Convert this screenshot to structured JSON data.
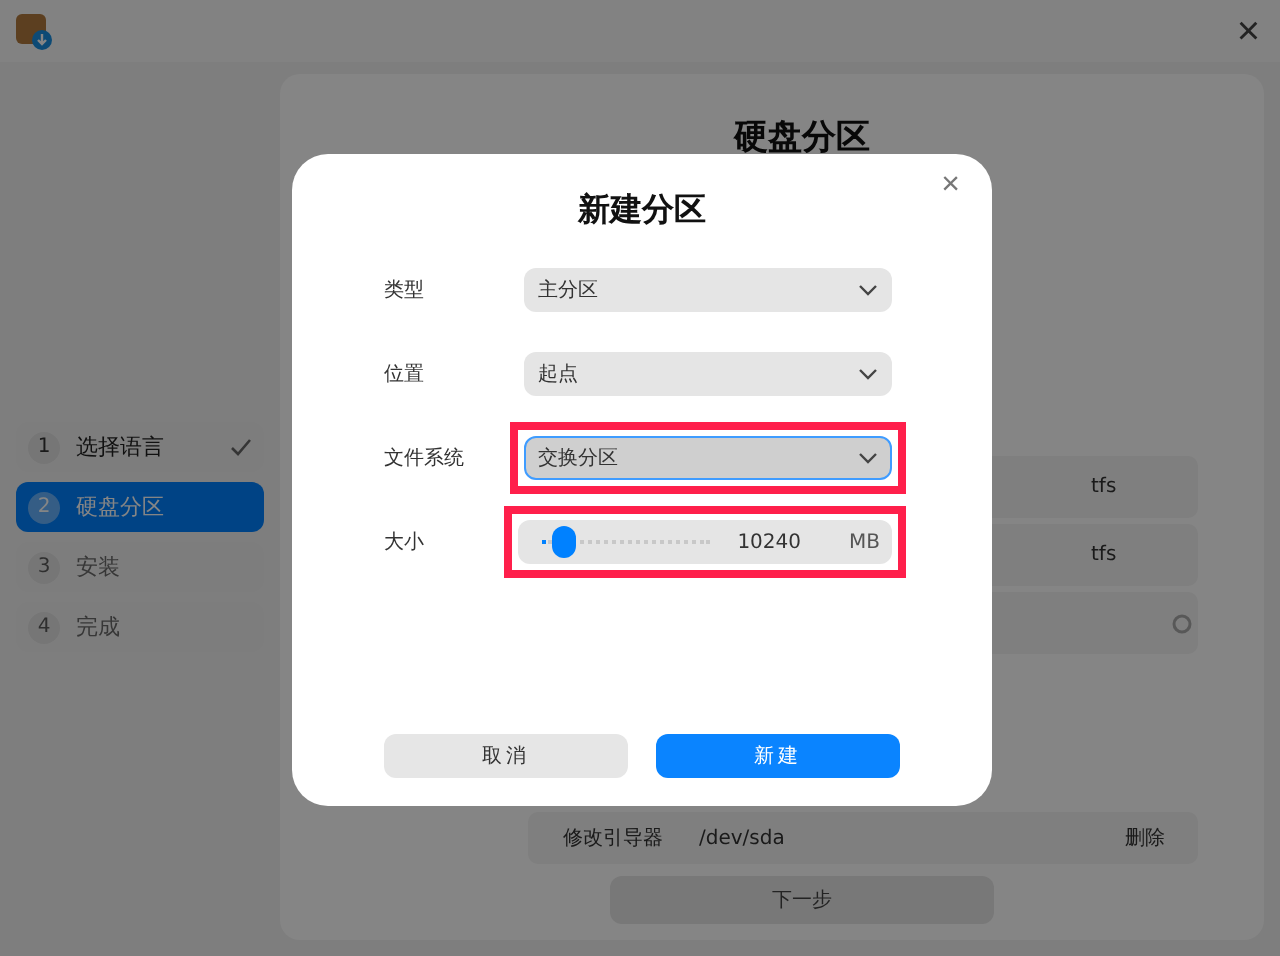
{
  "window": {
    "close": "×"
  },
  "steps": [
    {
      "number": "1",
      "label": "选择语言",
      "done": true,
      "selected": false,
      "disabled": false
    },
    {
      "number": "2",
      "label": "硬盘分区",
      "done": false,
      "selected": true,
      "disabled": false
    },
    {
      "number": "3",
      "label": "安装",
      "done": false,
      "selected": false,
      "disabled": true
    },
    {
      "number": "4",
      "label": "完成",
      "done": false,
      "selected": false,
      "disabled": true
    }
  ],
  "page_title": "硬盘分区",
  "partitions": [
    {
      "text": "tfs",
      "kind": "text"
    },
    {
      "text": "tfs",
      "kind": "text"
    },
    {
      "kind": "icon"
    }
  ],
  "bootloader": {
    "label": "修改引导器",
    "device": "/dev/sda",
    "action": "删除"
  },
  "next_button": "下一步",
  "dialog": {
    "title": "新建分区",
    "close": "×",
    "fields": [
      {
        "kind": "select",
        "label": "类型",
        "value": "主分区",
        "focused": false,
        "highlighted": false
      },
      {
        "kind": "select",
        "label": "位置",
        "value": "起点",
        "focused": false,
        "highlighted": false
      },
      {
        "kind": "select",
        "label": "文件系统",
        "value": "交换分区",
        "focused": true,
        "highlighted": true
      },
      {
        "kind": "slider",
        "label": "大小",
        "level": 0.14,
        "value": "10240",
        "unit": "MB",
        "highlighted": true
      }
    ],
    "buttons": [
      {
        "label": "取消",
        "primary": false
      },
      {
        "label": "新建",
        "primary": true
      }
    ]
  }
}
